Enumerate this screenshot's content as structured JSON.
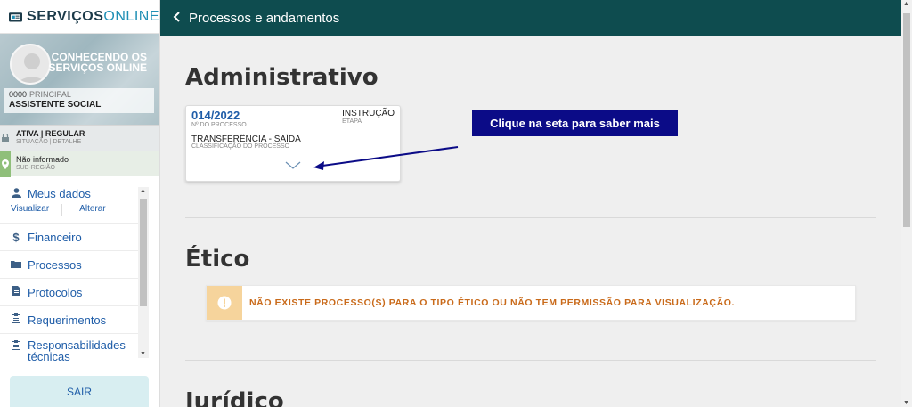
{
  "brand": {
    "name_bold": "SERVIÇOS",
    "name_light": "ONLINE"
  },
  "profile": {
    "title_line1": "CONHECENDO OS",
    "title_line2": "SERVIÇOS ONLINE",
    "registration_number": "0000",
    "registration_type": "PRINCIPAL",
    "profession": "ASSISTENTE SOCIAL"
  },
  "status": {
    "situation": "ATIVA | REGULAR",
    "situation_label": "SITUAÇÃO | DETALHE",
    "subregion": "Não informado",
    "subregion_label": "SUB-REGIÃO"
  },
  "menu": {
    "meus_dados": "Meus dados",
    "visualizar": "Visualizar",
    "alterar": "Alterar",
    "financeiro": "Financeiro",
    "processos": "Processos",
    "protocolos": "Protocolos",
    "requerimentos": "Requerimentos",
    "responsabilidades": "Responsabilidades técnicas",
    "logout": "SAIR"
  },
  "header": {
    "title": "Processos e andamentos"
  },
  "sections": {
    "administrativo": "Administrativo",
    "etico": "Ético",
    "juridico": "Jurídico"
  },
  "process_card": {
    "number": "014/2022",
    "number_label": "Nº DO PROCESSO",
    "stage": "INSTRUÇÃO",
    "stage_label": "ETAPA",
    "classification": "TRANSFERÊNCIA - SAÍDA",
    "classification_label": "CLASSIFICAÇÃO DO PROCESSO"
  },
  "etico_alert": "NÃO EXISTE PROCESSO(S) PARA O TIPO ÉTICO OU NÃO TEM PERMISSÃO PARA VISUALIZAÇÃO.",
  "annotation": {
    "tip": "Clique na seta para saber mais"
  },
  "colors": {
    "header_bg": "#0e4c4f",
    "link": "#1f5da8",
    "alert_text": "#c96a1a",
    "tip_bg": "#0b0b87"
  }
}
